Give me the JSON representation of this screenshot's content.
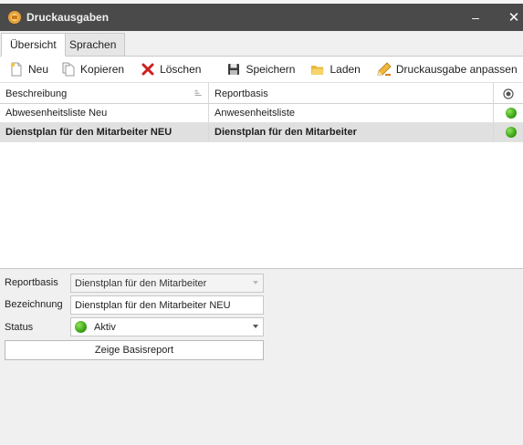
{
  "window": {
    "title": "Druckausgaben",
    "app_icon": "printer-app-icon",
    "minimize_label": "–",
    "close_label": "✕"
  },
  "tabs": [
    {
      "label": "Übersicht",
      "active": true
    },
    {
      "label": "Sprachen",
      "active": false
    }
  ],
  "toolbar": {
    "items": [
      {
        "label": "Neu",
        "icon": "new-document-icon"
      },
      {
        "label": "Kopieren",
        "icon": "copy-icon"
      },
      {
        "label": "Löschen",
        "icon": "delete-icon"
      },
      {
        "label": "Speichern",
        "icon": "save-icon"
      },
      {
        "label": "Laden",
        "icon": "folder-open-icon"
      },
      {
        "label": "Druckausgabe anpassen",
        "icon": "edit-pencil-icon"
      }
    ],
    "overflow_icon": "printer-icon"
  },
  "grid": {
    "columns": [
      "Beschreibung",
      "Reportbasis",
      ""
    ],
    "sort_icon": "sort-icon",
    "status_column_icon": "radio-icon",
    "rows": [
      {
        "beschreibung": "Abwesenheitsliste Neu",
        "reportbasis": "Anwesenheitsliste",
        "status": "active",
        "selected": false
      },
      {
        "beschreibung": "Dienstplan für den Mitarbeiter NEU",
        "reportbasis": "Dienstplan für den Mitarbeiter",
        "status": "active",
        "selected": true
      }
    ]
  },
  "form": {
    "reportbasis_label": "Reportbasis",
    "reportbasis_value": "Dienstplan für den Mitarbeiter",
    "bezeichnung_label": "Bezeichnung",
    "bezeichnung_value": "Dienstplan für den Mitarbeiter NEU",
    "status_label": "Status",
    "status_value": "Aktiv",
    "base_report_button": "Zeige Basisreport"
  },
  "colors": {
    "titlebar": "#4a4a4a",
    "status_active": "#3aa314",
    "delete_red": "#cc1f1f",
    "selected_row": "#e0e0e0"
  }
}
